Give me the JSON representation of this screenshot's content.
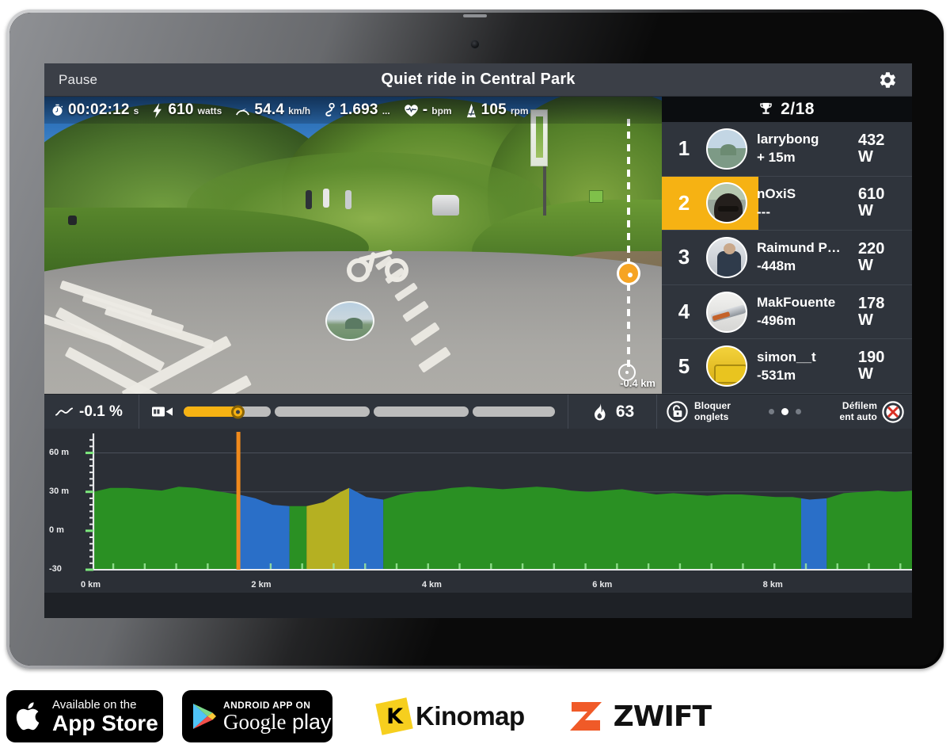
{
  "titlebar": {
    "pause_label": "Pause",
    "title": "Quiet ride in Central Park",
    "gear_icon": "gear-icon"
  },
  "stats": [
    {
      "icon": "stopwatch-icon",
      "value": "00:02:12",
      "unit": "s"
    },
    {
      "icon": "bolt-icon",
      "value": "610",
      "unit": "watts"
    },
    {
      "icon": "speedometer-icon",
      "value": "54.4",
      "unit": "km/h"
    },
    {
      "icon": "route-icon",
      "value": "1.693",
      "unit": "..."
    },
    {
      "icon": "heart-icon",
      "value": "-",
      "unit": "bpm"
    },
    {
      "icon": "cadence-icon",
      "value": "105",
      "unit": "rpm"
    }
  ],
  "video": {
    "rider_bubble": "rider-avatar-bubble",
    "vertical_slider_label": "-0.4 km"
  },
  "leaderboard": {
    "trophy_icon": "trophy-icon",
    "position_text": "2/18",
    "rows": [
      {
        "rank": "1",
        "name": "larrybong",
        "gap": "+ 15m",
        "power": "432",
        "power_unit": "W",
        "highlight": false,
        "avatar": "av1"
      },
      {
        "rank": "2",
        "name": "nOxiS",
        "gap": "---",
        "power": "610",
        "power_unit": "W",
        "highlight": true,
        "avatar": "av2"
      },
      {
        "rank": "3",
        "name": "Raimund P…",
        "gap": "-448m",
        "power": "220",
        "power_unit": "W",
        "highlight": false,
        "avatar": "av3"
      },
      {
        "rank": "4",
        "name": "MakFouente",
        "gap": "-496m",
        "power": "178",
        "power_unit": "W",
        "highlight": false,
        "avatar": "av4"
      },
      {
        "rank": "5",
        "name": "simon__t",
        "gap": "-531m",
        "power": "190",
        "power_unit": "W",
        "highlight": false,
        "avatar": "av5"
      }
    ]
  },
  "controlbar": {
    "grade_icon": "slope-icon",
    "grade_value": "-0.1 %",
    "video_icon": "video-camera-icon",
    "calories_icon": "flame-icon",
    "calories_value": "63",
    "lock_icon": "padlock-open-icon",
    "lock_label_line1": "Bloquer",
    "lock_label_line2": "onglets",
    "autoscroll_label_line1": "Défilem",
    "autoscroll_label_line2": "ent auto",
    "autoscroll_icon": "no-autoscroll-icon",
    "page_dots": 3,
    "page_dot_active": 1
  },
  "chart_data": {
    "type": "area",
    "title": "",
    "xlabel": "",
    "ylabel": "",
    "xlim": [
      0,
      9.6
    ],
    "ylim": [
      -30,
      75
    ],
    "x_ticks": [
      "0 km",
      "2 km",
      "4 km",
      "6 km",
      "8 km"
    ],
    "x_tick_values": [
      0,
      2,
      4,
      6,
      8
    ],
    "y_ticks": [
      "60 m",
      "30 m",
      "0 m",
      "-30"
    ],
    "y_tick_values": [
      60,
      30,
      0,
      -30
    ],
    "grid": true,
    "colors": {
      "green": "#2a9023",
      "blue": "#2a6fc8",
      "yellow": "#b5b022",
      "marker": "#f08a1c"
    },
    "position_marker_km": 1.7,
    "series": [
      {
        "name": "elevation",
        "x": [
          0.0,
          0.2,
          0.4,
          0.6,
          0.8,
          1.0,
          1.2,
          1.4,
          1.6,
          1.7,
          1.9,
          2.1,
          2.3,
          2.5,
          2.7,
          2.9,
          3.0,
          3.2,
          3.4,
          3.6,
          3.8,
          4.0,
          4.2,
          4.4,
          4.6,
          4.8,
          5.0,
          5.2,
          5.4,
          5.6,
          5.8,
          6.0,
          6.2,
          6.4,
          6.6,
          6.8,
          7.0,
          7.2,
          7.4,
          7.6,
          7.8,
          8.0,
          8.2,
          8.4,
          8.6,
          8.8,
          9.0,
          9.2,
          9.4,
          9.6
        ],
        "y": [
          30,
          33,
          33,
          32,
          31,
          34,
          33,
          31,
          29,
          28,
          25,
          20,
          19,
          19,
          22,
          30,
          33,
          26,
          24,
          28,
          30,
          31,
          33,
          34,
          33,
          32,
          33,
          34,
          33,
          31,
          30,
          31,
          32,
          30,
          28,
          29,
          28,
          27,
          28,
          28,
          27,
          26,
          26,
          24,
          25,
          29,
          30,
          31,
          30,
          31
        ]
      }
    ],
    "segments": [
      {
        "from": 0.0,
        "to": 1.7,
        "color": "green"
      },
      {
        "from": 1.7,
        "to": 2.3,
        "color": "blue"
      },
      {
        "from": 2.3,
        "to": 2.5,
        "color": "green"
      },
      {
        "from": 2.5,
        "to": 3.0,
        "color": "yellow"
      },
      {
        "from": 3.0,
        "to": 3.4,
        "color": "blue"
      },
      {
        "from": 3.4,
        "to": 8.3,
        "color": "green"
      },
      {
        "from": 8.3,
        "to": 8.6,
        "color": "blue"
      },
      {
        "from": 8.6,
        "to": 9.6,
        "color": "green"
      }
    ]
  },
  "badges": {
    "appstore_line1": "Available on the",
    "appstore_line2": "App Store",
    "appstore_icon": "apple-logo-icon",
    "googleplay_line1": "ANDROID APP ON",
    "googleplay_line2a": "Google",
    "googleplay_line2b": "play",
    "googleplay_icon": "google-play-triangle-icon",
    "kinomap_mark": "K",
    "kinomap_label": "Kinomap",
    "zwift_mark": "Z",
    "zwift_label": "ZWIFT"
  }
}
